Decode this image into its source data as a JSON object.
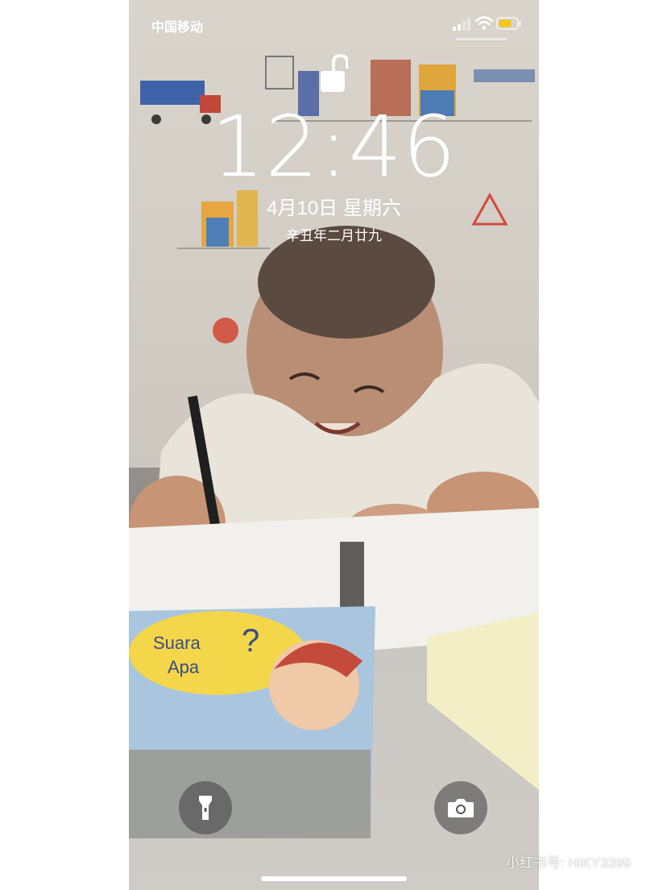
{
  "status_bar": {
    "carrier": "中国移动",
    "signal_icon": "signal-bars-icon",
    "wifi_icon": "wifi-icon",
    "battery_icon": "battery-icon",
    "battery_color": "#f5c518"
  },
  "lock_screen": {
    "lock_icon": "unlocked-padlock-icon",
    "time": "12:46",
    "date": "4月10日 星期六",
    "lunar_date": "辛丑年二月廿九"
  },
  "controls": {
    "flashlight_icon": "flashlight-icon",
    "camera_icon": "camera-icon"
  },
  "watermark": {
    "logo": "小红书",
    "text": "小红书号: HIKY3399"
  }
}
